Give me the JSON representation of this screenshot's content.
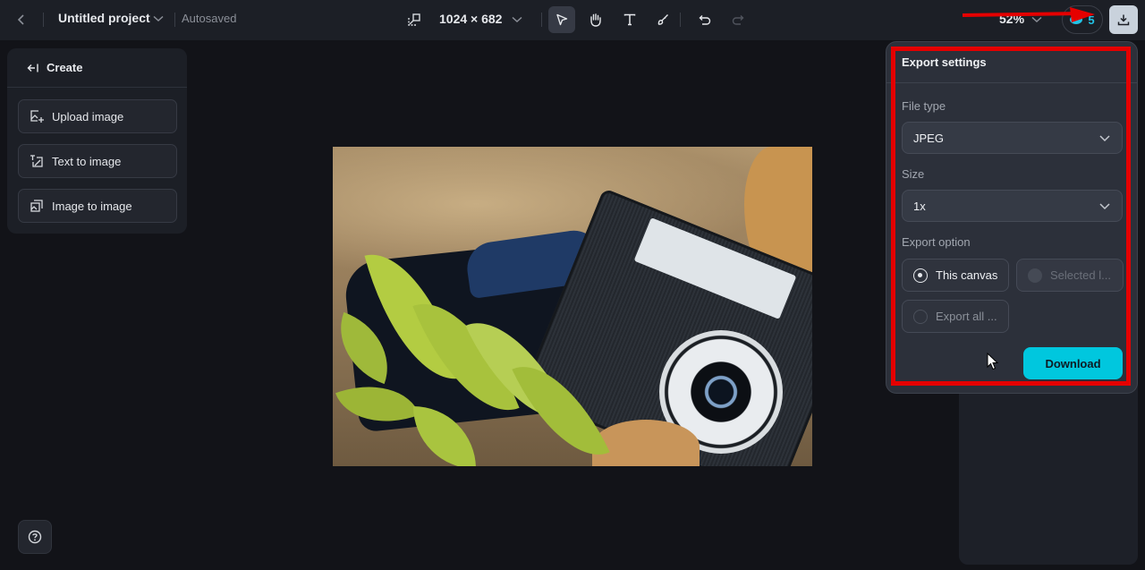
{
  "topbar": {
    "project_title": "Untitled project",
    "autosave_status": "Autosaved",
    "canvas_dimensions": "1024 × 682",
    "tools": [
      {
        "name": "select",
        "icon": "cursor-arrow-icon",
        "active": true
      },
      {
        "name": "hand",
        "icon": "hand-icon",
        "active": false
      },
      {
        "name": "text",
        "icon": "text-icon",
        "active": false
      },
      {
        "name": "brush",
        "icon": "brush-icon",
        "active": false
      },
      {
        "name": "undo",
        "icon": "undo-icon",
        "active": false
      },
      {
        "name": "redo",
        "icon": "redo-icon",
        "active": false,
        "disabled": true
      }
    ],
    "zoom_level": "52%",
    "credits_count": "5"
  },
  "create_panel": {
    "header": "Create",
    "buttons": [
      {
        "label": "Upload image",
        "icon": "upload-image-icon"
      },
      {
        "label": "Text to image",
        "icon": "text-to-image-icon"
      },
      {
        "label": "Image to image",
        "icon": "image-to-image-icon"
      }
    ]
  },
  "export_settings": {
    "title": "Export settings",
    "file_type_label": "File type",
    "file_type_value": "JPEG",
    "size_label": "Size",
    "size_value": "1x",
    "export_option_label": "Export option",
    "options": [
      {
        "label": "This canvas",
        "selected": true,
        "disabled": false
      },
      {
        "label": "Selected l...",
        "selected": false,
        "disabled": true
      },
      {
        "label": "Export all ...",
        "selected": false,
        "disabled": false
      }
    ],
    "download_label": "Download"
  },
  "colors": {
    "accent": "#00c7de",
    "annotation": "#e50000",
    "background": "#121318",
    "panel": "#1c1f26"
  }
}
